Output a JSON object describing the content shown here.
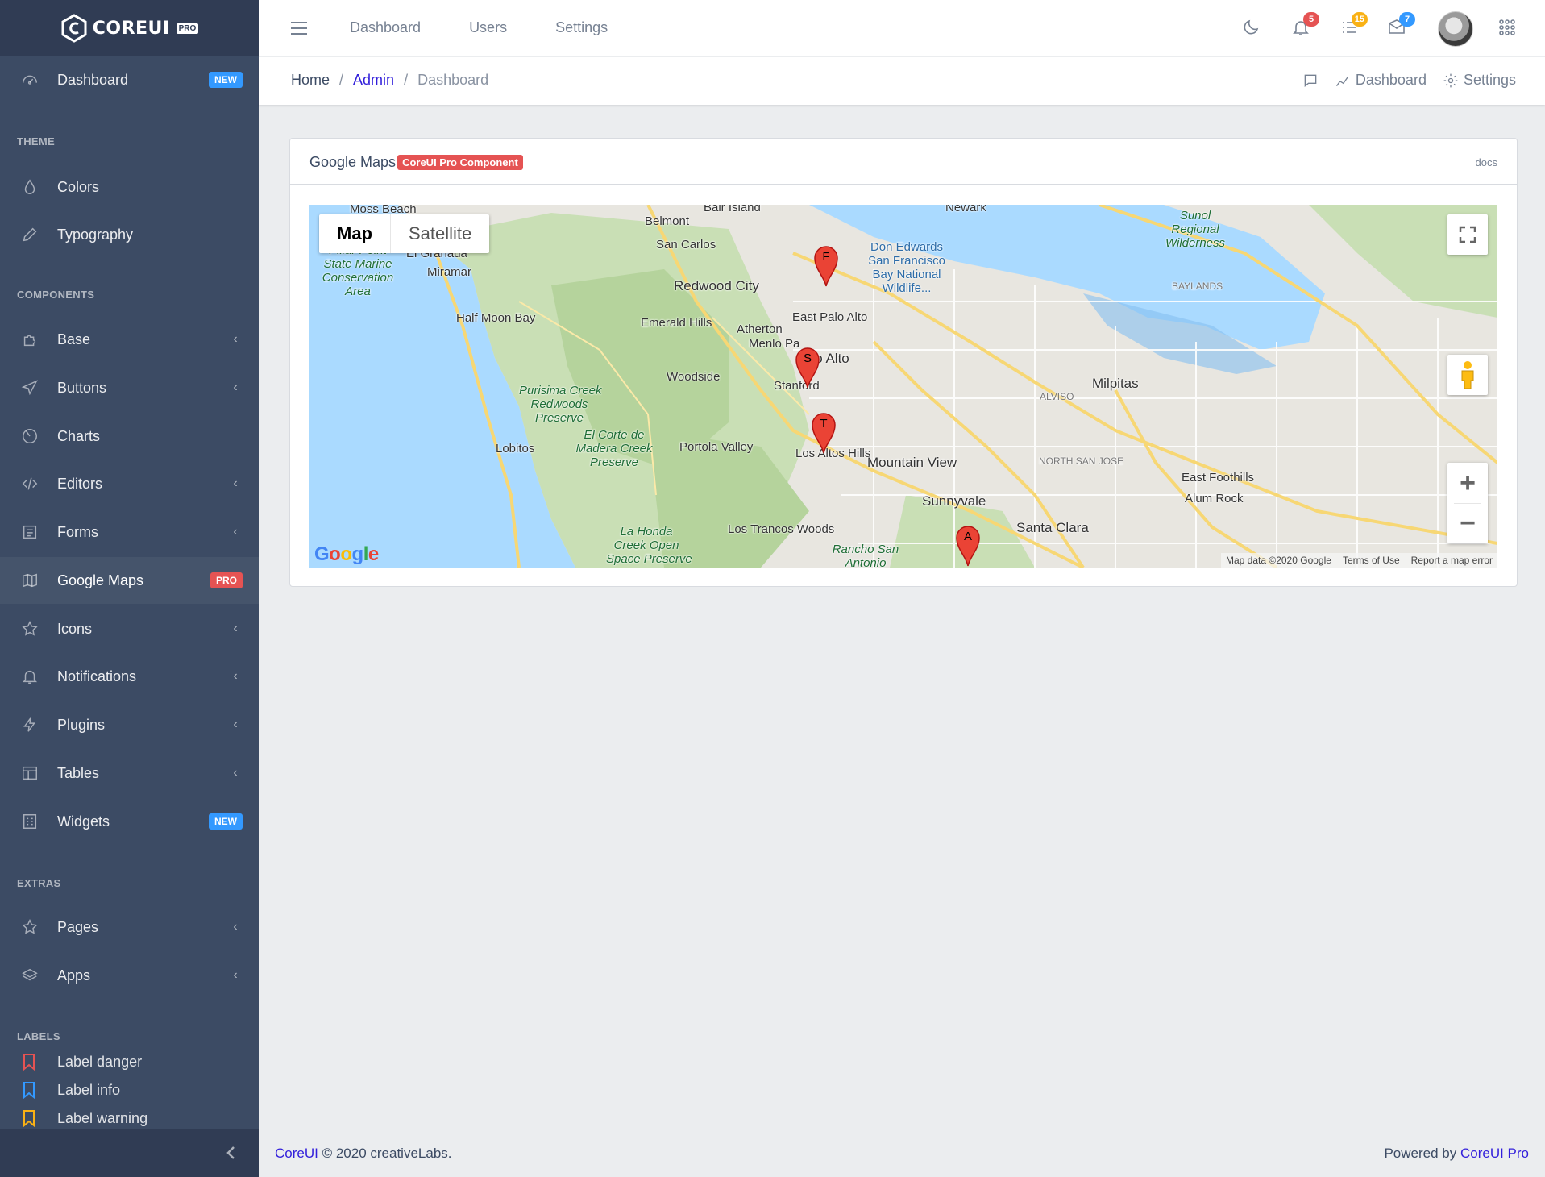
{
  "brand": {
    "name": "COREUI",
    "edition": "PRO"
  },
  "sidebar": {
    "items": [
      {
        "label": "Dashboard",
        "icon": "speedometer-icon",
        "badge": "NEW",
        "badge_color": "#39f"
      },
      {
        "section": "THEME"
      },
      {
        "label": "Colors",
        "icon": "drop-icon"
      },
      {
        "label": "Typography",
        "icon": "pencil-icon"
      },
      {
        "section": "COMPONENTS"
      },
      {
        "label": "Base",
        "icon": "puzzle-icon"
      },
      {
        "label": "Buttons",
        "icon": "cursor-icon"
      },
      {
        "label": "Charts",
        "icon": "chart-pie-icon"
      },
      {
        "label": "Editors",
        "icon": "code-icon"
      },
      {
        "label": "Forms",
        "icon": "notes-icon"
      },
      {
        "label": "Google Maps",
        "icon": "map-icon",
        "badge": "PRO",
        "badge_color": "#e55353"
      },
      {
        "label": "Icons",
        "icon": "star-icon"
      },
      {
        "label": "Notifications",
        "icon": "bell-icon"
      },
      {
        "label": "Plugins",
        "icon": "bolt-icon"
      },
      {
        "label": "Tables",
        "icon": "columns-icon"
      },
      {
        "label": "Widgets",
        "icon": "calculator-icon",
        "badge": "NEW",
        "badge_color": "#39f"
      },
      {
        "section": "EXTRAS"
      },
      {
        "label": "Pages",
        "icon": "star-icon"
      },
      {
        "label": "Apps",
        "icon": "layers-icon"
      },
      {
        "section": "LABELS"
      },
      {
        "label": "Label danger",
        "icon": "bookmark-icon",
        "color": "#e55353"
      },
      {
        "label": "Label info",
        "icon": "bookmark-icon",
        "color": "#39f"
      },
      {
        "label": "Label warning",
        "icon": "bookmark-icon",
        "color": "#f9b115"
      }
    ],
    "section_theme": "THEME",
    "section_components": "COMPONENTS",
    "section_extras": "EXTRAS",
    "section_labels": "LABELS",
    "dashboard": "Dashboard",
    "dashboard_badge": "NEW",
    "colors": "Colors",
    "typography": "Typography",
    "base": "Base",
    "buttons": "Buttons",
    "charts": "Charts",
    "editors": "Editors",
    "forms": "Forms",
    "google_maps": "Google Maps",
    "google_maps_badge": "PRO",
    "icons": "Icons",
    "notifications": "Notifications",
    "plugins": "Plugins",
    "tables": "Tables",
    "widgets": "Widgets",
    "widgets_badge": "NEW",
    "pages": "Pages",
    "apps": "Apps",
    "label_danger": "Label danger",
    "label_info": "Label info",
    "label_warning": "Label warning"
  },
  "header": {
    "nav": [
      "Dashboard",
      "Users",
      "Settings"
    ],
    "nav_dashboard": "Dashboard",
    "nav_users": "Users",
    "nav_settings": "Settings",
    "notifications_count": "5",
    "tasks_count": "15",
    "messages_count": "7",
    "badge_colors": {
      "notifications": "#e55353",
      "tasks": "#f9b115",
      "messages": "#39f"
    }
  },
  "subheader": {
    "breadcrumb": [
      "Home",
      "Admin",
      "Dashboard"
    ],
    "crumb_home": "Home",
    "crumb_admin": "Admin",
    "crumb_current": "Dashboard",
    "link_dashboard": "Dashboard",
    "link_settings": "Settings"
  },
  "card": {
    "title": "Google Maps",
    "pro_badge": "CoreUI Pro Component",
    "docs": "docs"
  },
  "map": {
    "type_map": "Map",
    "type_satellite": "Satellite",
    "markers": [
      "F",
      "S",
      "T",
      "A"
    ],
    "marker_f": "F",
    "marker_s": "S",
    "marker_t": "T",
    "marker_a": "A",
    "logo": "Google",
    "attribution_data": "Map data ©2020 Google",
    "attribution_terms": "Terms of Use",
    "attribution_report": "Report a map error",
    "places": {
      "moss_beach": "Moss Beach",
      "belmont": "Belmont",
      "san_carlos": "San Carlos",
      "redwood_city": "Redwood City",
      "pillar_point": "Pillar Point\nState Marine\nConservation\nArea",
      "el_granada": "El Granada",
      "miramar": "Miramar",
      "half_moon_bay": "Half\nMoon Bay",
      "emerald_hills": "Emerald Hills",
      "atherton": "Atherton",
      "menlo_park": "Menlo Pa",
      "east_palo_alto": "East Palo Alto",
      "palo_alto": "alo Alto",
      "woodside": "Woodside",
      "stanford": "Stanford",
      "purisima": "Purisima Creek\nRedwoods\nPreserve",
      "el_corte": "El Corte de\nMadera Creek\nPreserve",
      "portola_valley": "Portola Valley",
      "lobitos": "Lobitos",
      "los_altos_hills": "Los Altos Hills",
      "mountain_view": "Mountain\nView",
      "sunnyvale": "Sunnyvale",
      "santa_clara": "Santa Clara",
      "milpitas": "Milpitas",
      "alviso": "ALVISO",
      "north_san_jose": "NORTH SAN JOSE",
      "baylands": "BAYLANDS",
      "don_edwards": "Don Edwards\nSan Francisco\nBay National\nWildlife...",
      "sunol": "Sunol\nRegional\nWilderness",
      "newark": "Newark",
      "east_foothills": "East Foothills",
      "alum_rock": "Alum Rock",
      "la_honda": "La Honda\nCreek Open\nSpace Preserve",
      "los_trancos": "Los Trancos\nWoods",
      "rancho_san_antonio": "Rancho San\nAntonio",
      "bair_island": "Bair Island"
    }
  },
  "footer": {
    "brand": "CoreUI",
    "copyright": "© 2020 creativeLabs.",
    "powered_by": "Powered by",
    "powered_link": "CoreUI Pro"
  }
}
